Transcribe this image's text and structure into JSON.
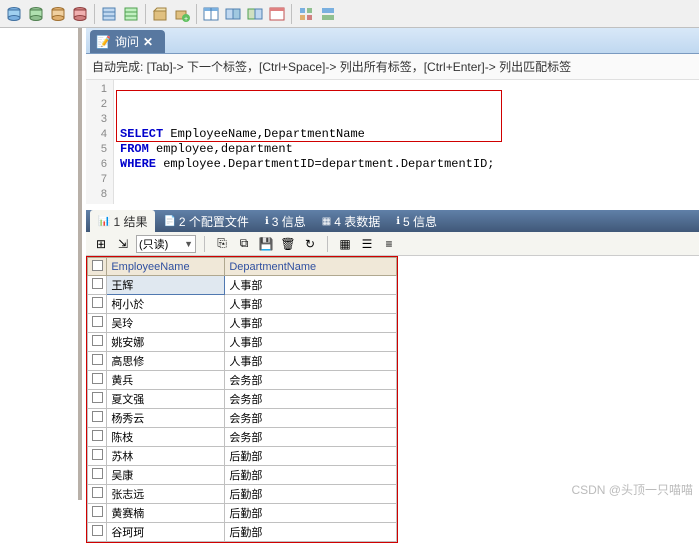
{
  "main_toolbar_icons": [
    "db-cyl-1",
    "db-cyl-2",
    "db-cyl-3",
    "db-cyl-4",
    "sep",
    "grid-blue",
    "grid-green",
    "sep",
    "box-open",
    "box-add",
    "sep",
    "table-blue",
    "table-multi-1",
    "table-multi-2",
    "table-red",
    "sep",
    "grid-small-1",
    "grid-small-2"
  ],
  "query_tab": {
    "icon": "📝",
    "label": "询问",
    "close": "✕"
  },
  "hint_text": "自动完成: [Tab]-> 下一个标签，[Ctrl+Space]-> 列出所有标签，[Ctrl+Enter]-> 列出匹配标签",
  "gutter_lines": [
    "1",
    "2",
    "3",
    "4",
    "5",
    "6",
    "7",
    "8"
  ],
  "sql_lines": [
    {
      "parts": [
        {
          "t": ""
        }
      ]
    },
    {
      "parts": [
        {
          "t": "SELECT",
          "kw": true
        },
        {
          "t": " EmployeeName,DepartmentName"
        }
      ]
    },
    {
      "parts": [
        {
          "t": "FROM",
          "kw": true
        },
        {
          "t": " employee,department"
        }
      ]
    },
    {
      "parts": [
        {
          "t": "WHERE",
          "kw": true
        },
        {
          "t": " employee.DepartmentID=department.DepartmentID;"
        }
      ]
    },
    {
      "parts": [
        {
          "t": ""
        }
      ]
    },
    {
      "parts": [
        {
          "t": ""
        }
      ]
    },
    {
      "parts": [
        {
          "t": ""
        }
      ]
    },
    {
      "parts": [
        {
          "t": ""
        }
      ]
    }
  ],
  "result_tabs": [
    {
      "icon": "📊",
      "label": "1 结果",
      "active": true
    },
    {
      "icon": "📄",
      "label": "2 个配置文件"
    },
    {
      "icon": "ℹ",
      "label": "3 信息"
    },
    {
      "icon": "▦",
      "label": "4 表数据"
    },
    {
      "icon": "ℹ",
      "label": "5 信息"
    }
  ],
  "result_toolbar": {
    "readonly_label": "(只读)",
    "icons_left": [
      "grid-add",
      "grid-export"
    ],
    "icons_mid": [
      "copy",
      "duplicate",
      "save",
      "delete",
      "refresh"
    ],
    "icons_right": [
      "view-grid",
      "view-form",
      "view-text"
    ]
  },
  "grid": {
    "columns": [
      "EmployeeName",
      "DepartmentName"
    ],
    "rows": [
      {
        "c": [
          "王辉",
          "人事部"
        ],
        "sel": true
      },
      {
        "c": [
          "柯小於",
          "人事部"
        ]
      },
      {
        "c": [
          "吴玲",
          "人事部"
        ]
      },
      {
        "c": [
          "姚安娜",
          "人事部"
        ]
      },
      {
        "c": [
          "高思修",
          "人事部"
        ]
      },
      {
        "c": [
          "黄兵",
          "会务部"
        ]
      },
      {
        "c": [
          "夏文强",
          "会务部"
        ]
      },
      {
        "c": [
          "杨秀云",
          "会务部"
        ]
      },
      {
        "c": [
          "陈枝",
          "会务部"
        ]
      },
      {
        "c": [
          "苏林",
          "后勤部"
        ]
      },
      {
        "c": [
          "吴康",
          "后勤部"
        ]
      },
      {
        "c": [
          "张志远",
          "后勤部"
        ]
      },
      {
        "c": [
          "黄赛楠",
          "后勤部"
        ]
      },
      {
        "c": [
          "谷珂珂",
          "后勤部"
        ]
      }
    ]
  },
  "watermark": "CSDN @头顶一只喵喵"
}
